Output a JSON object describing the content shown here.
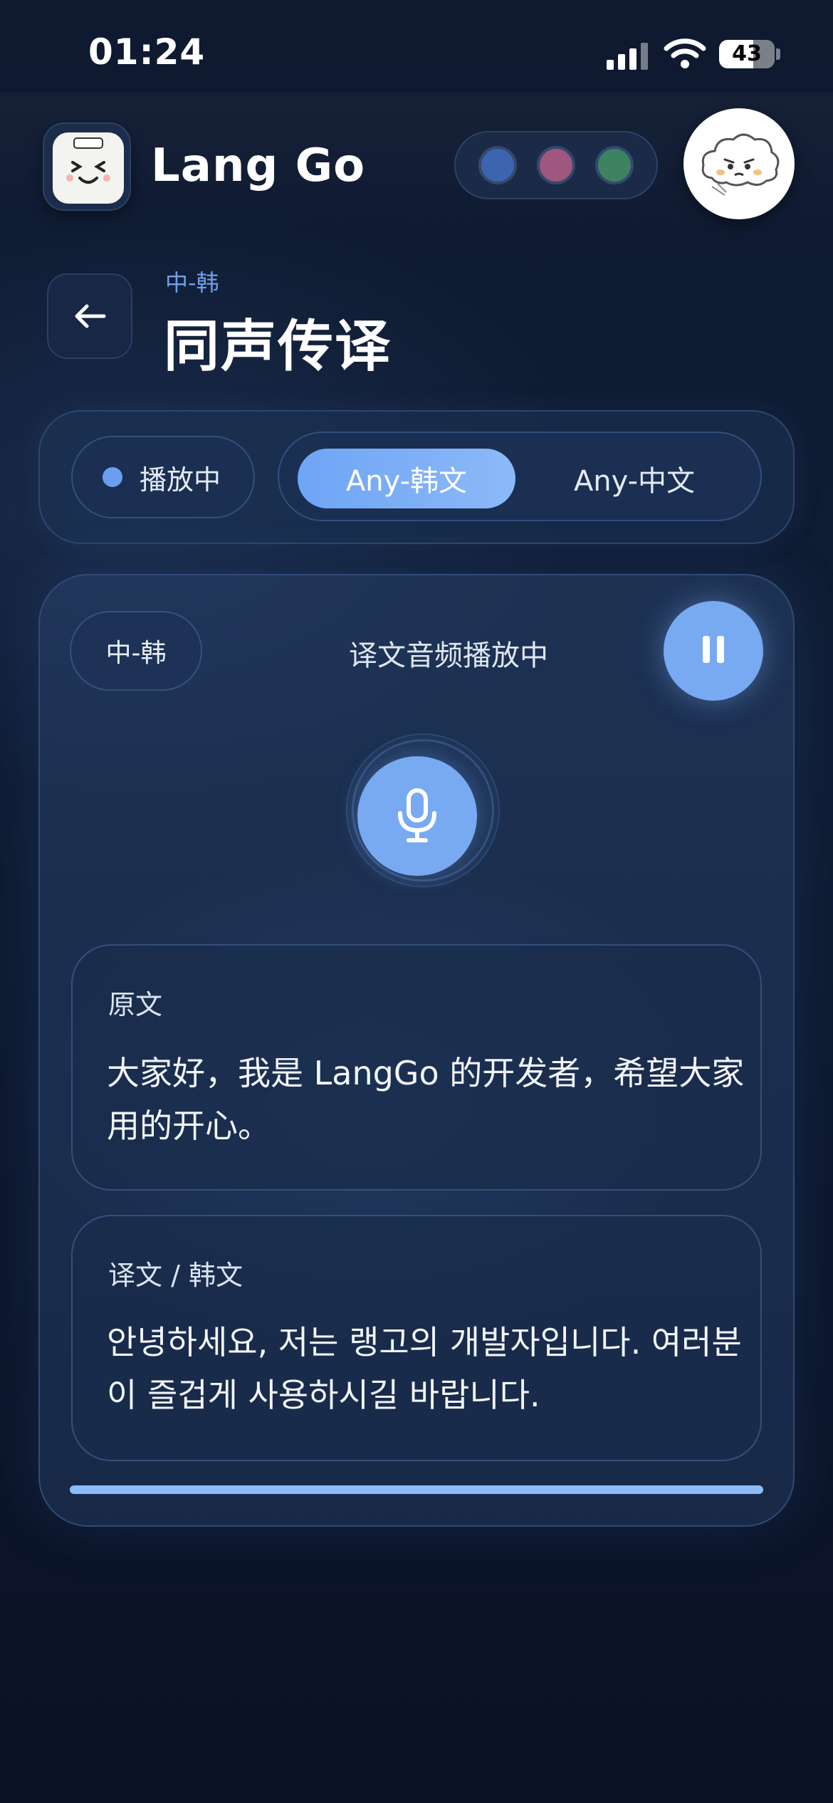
{
  "status_bar": {
    "time": "01:24",
    "battery": "43"
  },
  "header": {
    "app_title": "Lang Go",
    "theme_colors": [
      "#3c65b0",
      "#a0577f",
      "#3d8361"
    ]
  },
  "page": {
    "breadcrumb": "中-韩",
    "title": "同声传译"
  },
  "controls": {
    "status_label": "播放中",
    "modes": [
      {
        "label": "Any-韩文",
        "active": true
      },
      {
        "label": "Any-中文",
        "active": false
      }
    ]
  },
  "session": {
    "pair_label": "中-韩",
    "status_text": "译文音频播放中",
    "source": {
      "label": "原文",
      "text": "大家好，我是 LangGo 的开发者，希望大家用的开心。"
    },
    "target": {
      "label": "译文 / 韩文",
      "text": "안녕하세요, 저는 랭고의 개발자입니다. 여러분이 즐겁게 사용하시길 바랍니다."
    },
    "progress": 1.0
  },
  "colors": {
    "accent": "#78aaf2",
    "accent_light": "#8cbcf8",
    "crumb": "#6ea0ea",
    "background": "#0f1a31"
  }
}
